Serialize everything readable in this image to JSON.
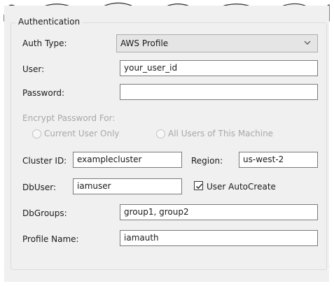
{
  "authentication": {
    "group_title": "Authentication",
    "auth_type": {
      "label": "Auth Type:",
      "value": "AWS Profile"
    },
    "user": {
      "label": "User:",
      "value": "your_user_id"
    },
    "password": {
      "label": "Password:",
      "value": ""
    },
    "encrypt": {
      "label": "Encrypt Password For:",
      "options": [
        {
          "label": "Current User Only",
          "selected": true
        },
        {
          "label": "All Users of This Machine",
          "selected": false
        }
      ]
    },
    "cluster_id": {
      "label": "Cluster ID:",
      "value": "examplecluster"
    },
    "region": {
      "label": "Region:",
      "value": "us-west-2"
    },
    "db_user": {
      "label": "DbUser:",
      "value": "iamuser"
    },
    "user_autocreate": {
      "label": "User AutoCreate",
      "checked": true
    },
    "db_groups": {
      "label": "DbGroups:",
      "value": "group1, group2"
    },
    "profile_name": {
      "label": "Profile Name:",
      "value": "iamauth"
    }
  },
  "colors": {
    "panel_bg": "#f0f0f0",
    "input_border": "#7a7a7a",
    "disabled_text": "#a8a8a8"
  },
  "icons": {
    "dropdown": "chevron-down-icon",
    "checkbox": "checkmark-icon"
  }
}
